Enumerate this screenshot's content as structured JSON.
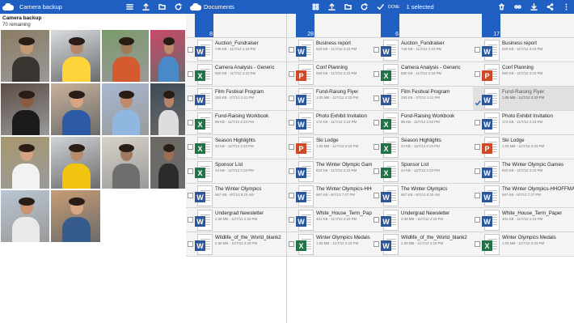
{
  "colors": {
    "accent": "#1f5fc2",
    "word": "#2b579a",
    "excel": "#217346",
    "powerpoint": "#d24726"
  },
  "camera": {
    "app_title": "Camera backup",
    "heading": "Camera backup",
    "remaining": "70 remaining",
    "toolbar_icons": [
      "list-icon",
      "upload-icon",
      "folder-icon",
      "refresh-icon"
    ]
  },
  "docs": {
    "app_title": "Documents",
    "toolbar_icons": [
      "grid-icon",
      "upload-icon",
      "folder-icon",
      "refresh-icon"
    ]
  },
  "selection": {
    "done_label": "DONE",
    "count_label": "1 selected",
    "toolbar_icons": [
      "delete-icon",
      "link-icon",
      "download-icon",
      "share-icon",
      "more-icon"
    ]
  },
  "listA": [
    {
      "name": "",
      "meta": "",
      "kind": "folder",
      "count": "8"
    },
    {
      "name": "Auction_Fundraiser",
      "meta": "745 KB - 11/7/12 2:23 PM",
      "kind": "word"
    },
    {
      "name": "Camera Analysis - Generic",
      "meta": "550 KB - 11/7/12 2:23 PM",
      "kind": "excel"
    },
    {
      "name": "Film Festival Program",
      "meta": "293 KB - 2/7/13 1:41 PM",
      "kind": "word"
    },
    {
      "name": "Fund-Raising Workbook",
      "meta": "89 KB - 11/7/12 2:23 PM",
      "kind": "excel"
    },
    {
      "name": "Season Highlights",
      "meta": "34 KB - 11/7/12 2:23 PM",
      "kind": "excel"
    },
    {
      "name": "Sponsor List",
      "meta": "24 KB - 11/7/12 2:23 PM",
      "kind": "excel"
    },
    {
      "name": "The Winter Olympics",
      "meta": "667 KB - 8/7/13 9:20 AM",
      "kind": "word"
    },
    {
      "name": "Undergrad Newsletter",
      "meta": "2.38 MB - 11/7/12 2:23 PM",
      "kind": "word"
    },
    {
      "name": "Wildlife_of_the_World_blank2",
      "meta": "2.38 MB - 11/7/12 2:23 PM",
      "kind": "word"
    }
  ],
  "listB": [
    {
      "name": "",
      "meta": "",
      "kind": "folder",
      "count": "28"
    },
    {
      "name": "Business report",
      "meta": "620 KB - 11/7/12 2:23 PM",
      "kind": "word"
    },
    {
      "name": "Conf Planning",
      "meta": "550 KB - 11/7/12 2:23 PM",
      "kind": "powerpoint"
    },
    {
      "name": "Fund-Raising Flyer",
      "meta": "1.05 MB - 11/7/12 2:23 PM",
      "kind": "word"
    },
    {
      "name": "Photo Exhibit Invitation",
      "meta": "172 KB - 11/7/12 2:23 PM",
      "kind": "word"
    },
    {
      "name": "Ski Lodge",
      "meta": "1.05 MB - 11/7/12 2:23 PM",
      "kind": "powerpoint"
    },
    {
      "name": "The Winter Olympic Games",
      "meta": "824 KB - 11/7/12 2:23 PM",
      "kind": "word"
    },
    {
      "name": "The Winter Olympics-HHOFI",
      "meta": "667 KB - 8/7/13 7:27 PM",
      "kind": "word"
    },
    {
      "name": "White_House_Term_Paper",
      "meta": "401 KB - 11/7/12 2:23 PM",
      "kind": "word"
    },
    {
      "name": "Winter Olympics Medals",
      "meta": "1.05 MB - 11/7/12 2:23 PM",
      "kind": "excel"
    }
  ],
  "listC": [
    {
      "name": "",
      "meta": "",
      "kind": "folder",
      "count": "6"
    },
    {
      "name": "Auction_Fundraiser",
      "meta": "745 KB - 11/7/12 2:23 PM",
      "kind": "word"
    },
    {
      "name": "Camera Analysis - Generic",
      "meta": "550 KB - 11/7/12 2:23 PM",
      "kind": "excel"
    },
    {
      "name": "Film Festival Program",
      "meta": "293 KB - 2/7/13 1:41 PM",
      "kind": "word"
    },
    {
      "name": "Fund-Raising Workbook",
      "meta": "89 KB - 11/7/12 2:23 PM",
      "kind": "excel"
    },
    {
      "name": "Season Highlights",
      "meta": "34 KB - 11/7/12 2:23 PM",
      "kind": "excel"
    },
    {
      "name": "Sponsor List",
      "meta": "24 KB - 11/7/12 2:23 PM",
      "kind": "excel"
    },
    {
      "name": "The Winter Olympics",
      "meta": "667 KB - 8/7/13 9:20 AM",
      "kind": "word"
    },
    {
      "name": "Undergrad Newsletter",
      "meta": "2.38 MB - 11/7/12 2:23 PM",
      "kind": "word"
    },
    {
      "name": "Wildlife_of_the_World_blank2",
      "meta": "2.38 MB - 11/7/12 2:23 PM",
      "kind": "word"
    }
  ],
  "listD": [
    {
      "name": "",
      "meta": "",
      "kind": "folder",
      "count": "17"
    },
    {
      "name": "Business report",
      "meta": "620 KB - 11/7/12 2:23 PM",
      "kind": "word"
    },
    {
      "name": "Conf Planning",
      "meta": "550 KB - 11/7/12 2:23 PM",
      "kind": "powerpoint"
    },
    {
      "name": "Fund-Raising Flyer",
      "meta": "1.05 MB - 11/7/12 2:23 PM",
      "kind": "word",
      "selected": true
    },
    {
      "name": "Photo Exhibit Invitation",
      "meta": "172 KB - 11/7/12 2:23 PM",
      "kind": "word"
    },
    {
      "name": "Ski Lodge",
      "meta": "1.05 MB - 11/7/12 2:23 PM",
      "kind": "powerpoint"
    },
    {
      "name": "The Winter Olympic Games",
      "meta": "824 KB - 11/7/12 2:23 PM",
      "kind": "word"
    },
    {
      "name": "The Winter Olympics-HHOFFMA",
      "meta": "667 KB - 8/7/13 7:27 PM",
      "kind": "word"
    },
    {
      "name": "White_House_Term_Paper",
      "meta": "401 KB - 11/7/12 2:23 PM",
      "kind": "word"
    },
    {
      "name": "Winter Olympics Medals",
      "meta": "1.05 MB - 11/7/12 2:23 PM",
      "kind": "excel"
    }
  ]
}
